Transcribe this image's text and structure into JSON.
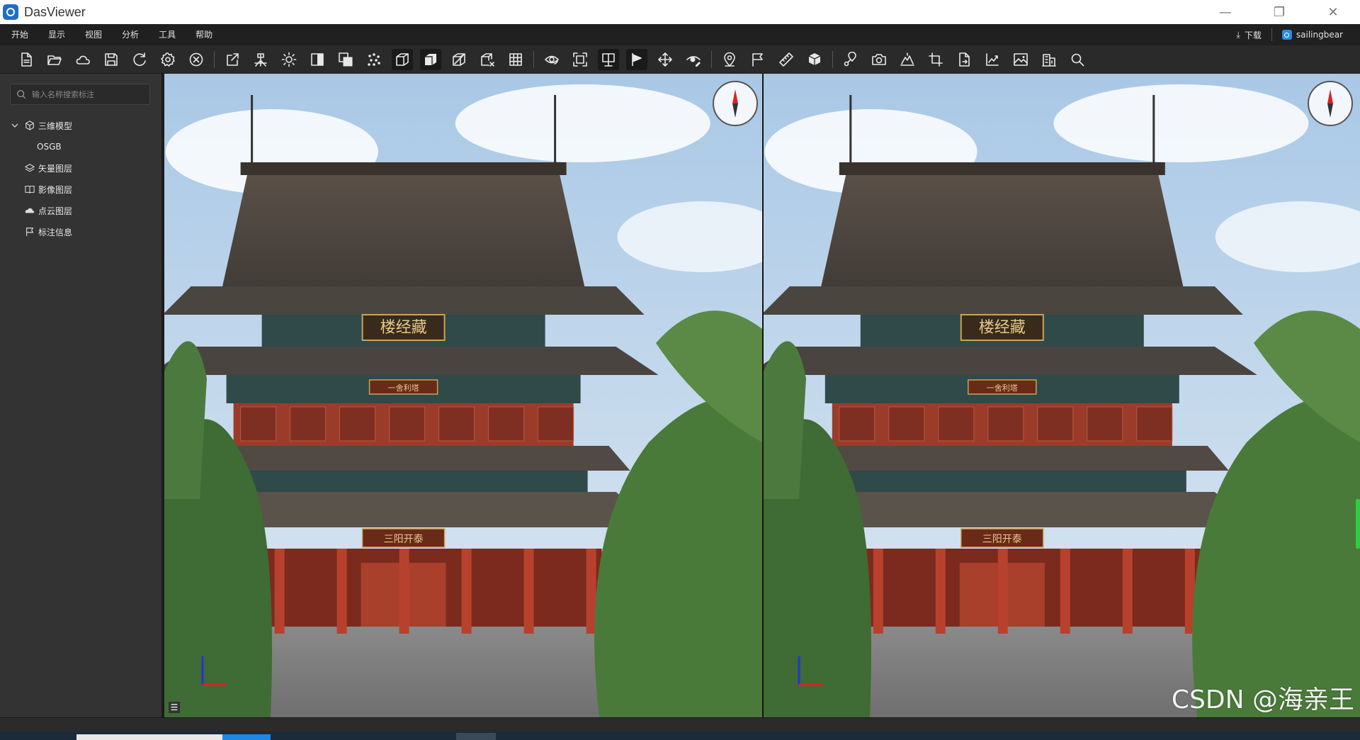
{
  "window": {
    "title": "DasViewer",
    "controls": [
      "—",
      "❐",
      "✕"
    ]
  },
  "menu": {
    "items": [
      "开始",
      "显示",
      "视图",
      "分析",
      "工具",
      "帮助"
    ],
    "download_label": "下载",
    "user_name": "sailingbear"
  },
  "toolbar": {
    "groups": [
      [
        "new-file",
        "open-folder",
        "cloud",
        "save",
        "refresh",
        "settings",
        "close-circle"
      ],
      [
        "export",
        "tripod",
        "light",
        "contrast",
        "layers-overlay",
        "point-cloud",
        "box-wireframe",
        "box-solid",
        "box-cut",
        "box-x",
        "grid"
      ],
      [
        "eye-orbit",
        "fullscreen",
        "split-view",
        "play-flag",
        "move",
        "eye-edit"
      ],
      [
        "pin",
        "flag",
        "ruler",
        "cube-measure"
      ],
      [
        "route-pin",
        "camera",
        "terrain",
        "crop",
        "file-export",
        "chart-export",
        "image",
        "building",
        "search"
      ]
    ],
    "active": [
      "box-wireframe",
      "box-solid",
      "split-view",
      "play-flag"
    ]
  },
  "sidebar": {
    "search_placeholder": "输入名称搜索标注",
    "tree": [
      {
        "label": "三维模型",
        "icon": "cube-icon",
        "expanded": true,
        "children": [
          {
            "label": "OSGB"
          }
        ]
      },
      {
        "label": "矢量图层",
        "icon": "layers-icon"
      },
      {
        "label": "影像图层",
        "icon": "book-icon"
      },
      {
        "label": "点云图层",
        "icon": "cloud-icon"
      },
      {
        "label": "标注信息",
        "icon": "flag-icon"
      }
    ]
  },
  "viewports": {
    "left": {
      "plaque_top": "楼经藏",
      "plaque_mid": "一舍利塔",
      "plaque_bottom": "三阳开泰"
    },
    "right": {
      "plaque_top": "楼经藏",
      "plaque_mid": "一舍利塔",
      "plaque_bottom": "三阳开泰"
    }
  },
  "watermark": "CSDN @海亲王",
  "colors": {
    "titlebar": "#ffffff",
    "menubar": "#202020",
    "toolbar": "#2a2a2a",
    "sidebar": "#333333",
    "accent": "#1e88e5",
    "slider": "#2ecc40"
  }
}
